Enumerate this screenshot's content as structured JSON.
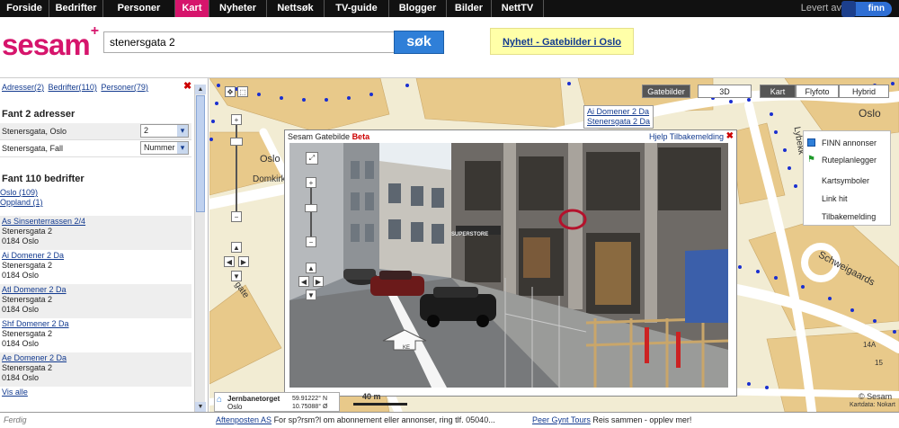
{
  "topnav": {
    "tabs": [
      "Forside",
      "Bedrifter",
      "Personer",
      "Kart",
      "Nyheter",
      "Nettsøk",
      "TV-guide",
      "Blogger",
      "Bilder",
      "NettTV"
    ],
    "active": "Kart",
    "levert_label": "Levert av",
    "finn_label": "finn"
  },
  "header": {
    "logo": "sesam",
    "search_value": "stenersgata 2",
    "search_button": "søk",
    "news_link": "Nyhet! - Gatebilder i Oslo"
  },
  "left": {
    "filter_links": [
      "Adresser(2)",
      "Bedrifter(110)",
      "Personer(79)"
    ],
    "addresses_heading": "Fant 2 adresser",
    "addresses": [
      {
        "label": "Stenersgata, Oslo",
        "select": "2"
      },
      {
        "label": "Stenersgata, Fall",
        "select": "Nummer"
      }
    ],
    "business_heading": "Fant 110 bedrifter",
    "regions": [
      "Oslo (109)",
      "Oppland (1)"
    ],
    "businesses": [
      {
        "name": "As Sinsenterrassen 2/4",
        "street": "Stenersgata 2",
        "city": "0184 Oslo"
      },
      {
        "name": "Ai Domener 2 Da",
        "street": "Stenersgata 2",
        "city": "0184 Oslo"
      },
      {
        "name": "Atl Domener 2 Da",
        "street": "Stenersgata 2",
        "city": "0184 Oslo"
      },
      {
        "name": "Shf Domener 2 Da",
        "street": "Stenersgata 2",
        "city": "0184 Oslo"
      },
      {
        "name": "Ae Domener 2 Da",
        "street": "Stenersgata 2",
        "city": "0184 Oslo"
      }
    ],
    "see_all": "Vis alle"
  },
  "map": {
    "gatebilder_button": "Gatebilder",
    "view_buttons": [
      "3D",
      "Kart",
      "Flyfoto",
      "Hybrid"
    ],
    "active_view": "Kart",
    "labels": {
      "oslo_center": "Oslo",
      "oslo_right": "Oslo",
      "domkirke": "Domkirke",
      "schweigaards": "Schweigaards",
      "lybekke": "Lybekk",
      "gate": "gate",
      "num14a": "14A",
      "num15": "15"
    },
    "popup_lines": [
      "Ai Domener 2 Da",
      "Stenersgata 2 Da"
    ],
    "menu_items": [
      "FINN annonser",
      "Ruteplanlegger",
      "Kartsymboler",
      "Link hit",
      "Tilbakemelding"
    ],
    "scale_label": "40 m",
    "copyright": "© Sesam",
    "copyright2": "Kartdata: Nokart",
    "coord_place": "Jernbanetorget",
    "coord_city": "Oslo",
    "coord_lat": "59.91222° N",
    "coord_lon": "10.75088° Ø"
  },
  "streetview": {
    "title": "Sesam Gatebilde",
    "beta": "Beta",
    "help": "Hjelp",
    "feedback": "Tilbakemelding",
    "sign_text": "SUPERSTORE",
    "plate": "KE"
  },
  "bottom": {
    "status": "Ferdig",
    "ad1_link": "Aftenposten AS",
    "ad1_text": "For sp?rsm?l om abonnement eller annonser, ring tlf. 05040...",
    "ad2_link": "Peer Gynt Tours",
    "ad2_text": "Reis sammen - opplev mer!"
  }
}
